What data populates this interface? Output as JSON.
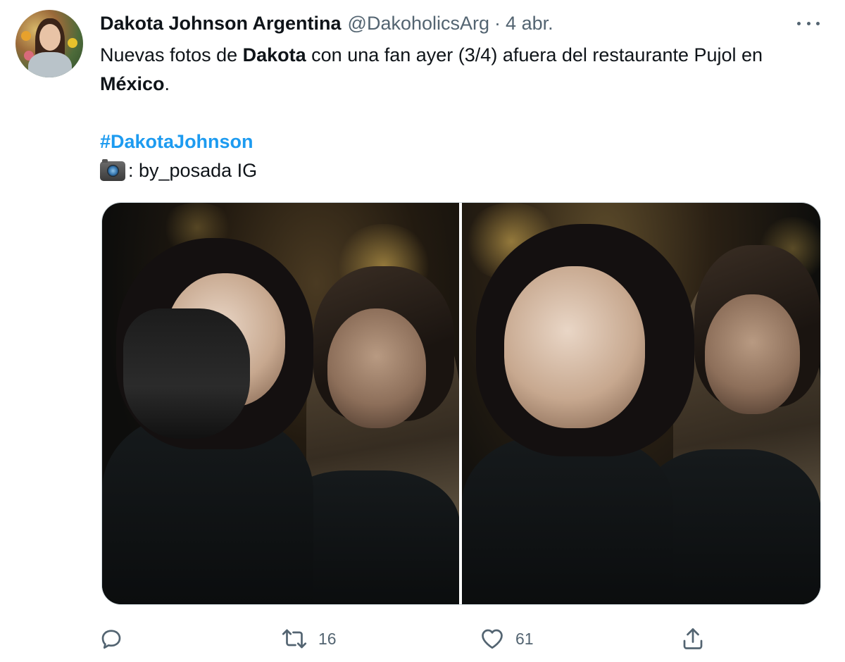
{
  "tweet": {
    "author_name": "Dakota Johnson Argentina",
    "author_handle": "@DakoholicsArg",
    "separator": "·",
    "date": "4 abr.",
    "text": {
      "part1": "Nuevas fotos de ",
      "bold1": "Dakota",
      "part2": " con una fan ayer (3/4) afuera del restaurante Pujol en ",
      "bold2": "México",
      "part3": ".",
      "hashtag": "#DakotaJohnson",
      "credit": ": by_posada IG"
    },
    "actions": {
      "replies_count": "",
      "retweets_count": "16",
      "likes_count": "61"
    },
    "icons": {
      "camera": "camera-with-flash-emoji",
      "reply": "reply-icon",
      "retweet": "retweet-icon",
      "like": "heart-icon",
      "share": "share-icon",
      "more": "more-icon"
    },
    "colors": {
      "link": "#1d9bf0",
      "text": "#0f1419",
      "secondary": "#536471"
    }
  }
}
